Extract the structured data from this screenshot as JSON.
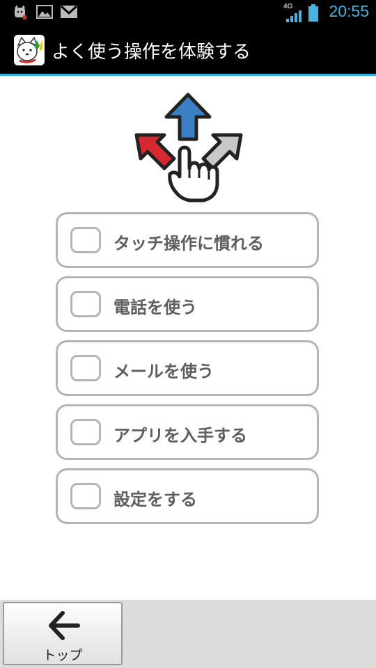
{
  "status_bar": {
    "time": "20:55",
    "network": "4G",
    "icons": [
      "dog-notification-icon",
      "image-notification-icon",
      "gmail-icon",
      "signal-icon",
      "battery-icon"
    ]
  },
  "action_bar": {
    "title": "よく使う操作を体験する",
    "app_icon": "dog-app-icon",
    "divider_color": "#3aaedc"
  },
  "hero": {
    "icon": "touch-gesture-arrows-icon",
    "colors": {
      "up": "#3b7fc4",
      "left": "#d7282f",
      "right": "#c8c8c8"
    }
  },
  "options": [
    {
      "label": "タッチ操作に慣れる",
      "checked": false
    },
    {
      "label": "電話を使う",
      "checked": false
    },
    {
      "label": "メールを使う",
      "checked": false
    },
    {
      "label": "アプリを入手する",
      "checked": false
    },
    {
      "label": "設定をする",
      "checked": false
    }
  ],
  "bottom_bar": {
    "back_label": "トップ",
    "back_icon": "arrow-left-icon"
  }
}
